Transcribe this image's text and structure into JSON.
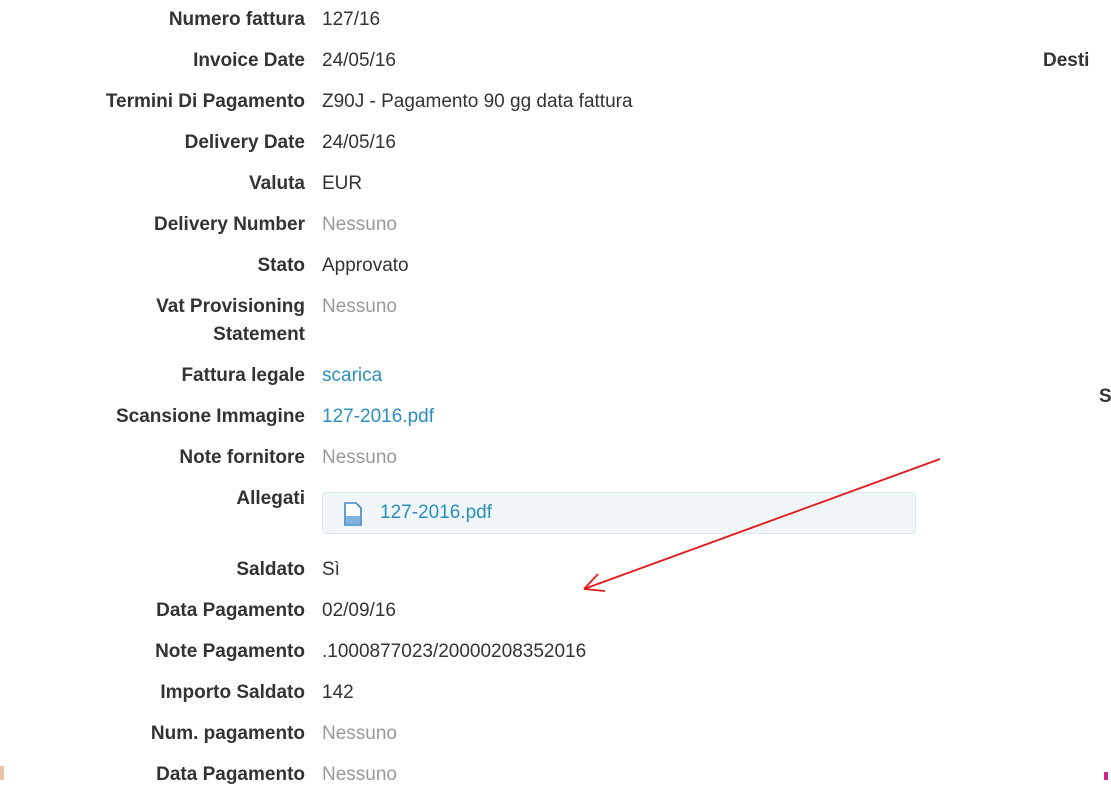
{
  "invoice": {
    "fields": [
      {
        "label": "Numero fattura",
        "value": "127/16"
      },
      {
        "label": "Invoice Date",
        "value": "24/05/16"
      },
      {
        "label": "Termini Di Pagamento",
        "value": "Z90J - Pagamento 90 gg data fattura"
      },
      {
        "label": "Delivery Date",
        "value": "24/05/16"
      },
      {
        "label": "Valuta",
        "value": "EUR"
      },
      {
        "label": "Delivery Number",
        "value": "Nessuno"
      },
      {
        "label": "Stato",
        "value": "Approvato"
      },
      {
        "label_line1": "Vat Provisioning",
        "label_line2": "Statement",
        "value": "Nessuno"
      },
      {
        "label": "Fattura legale",
        "value": "scarica"
      },
      {
        "label": "Scansione Immagine",
        "value": "127-2016.pdf"
      },
      {
        "label": "Note fornitore",
        "value": "Nessuno"
      },
      {
        "label": "Allegati",
        "value": "127-2016.pdf"
      },
      {
        "label": "Saldato",
        "value": "Sì"
      },
      {
        "label": "Data Pagamento",
        "value": "02/09/16"
      },
      {
        "label": "Note Pagamento",
        "value": ".1000877023/20000208352016"
      },
      {
        "label": "Importo Saldato",
        "value": "142"
      },
      {
        "label": "Num. pagamento",
        "value": "Nessuno"
      },
      {
        "label": "Data Pagamento",
        "value": "Nessuno"
      }
    ]
  },
  "right_column": {
    "label_top": "Desti",
    "label_mid": "S"
  },
  "icons": {
    "attachment": "file-icon",
    "annotation": "red-arrow"
  },
  "colors": {
    "link": "#2a8fbd",
    "muted": "#999999",
    "annotation": "#e31b1b",
    "edge_marks": [
      "#e8c3a8",
      "#d0218a"
    ]
  }
}
